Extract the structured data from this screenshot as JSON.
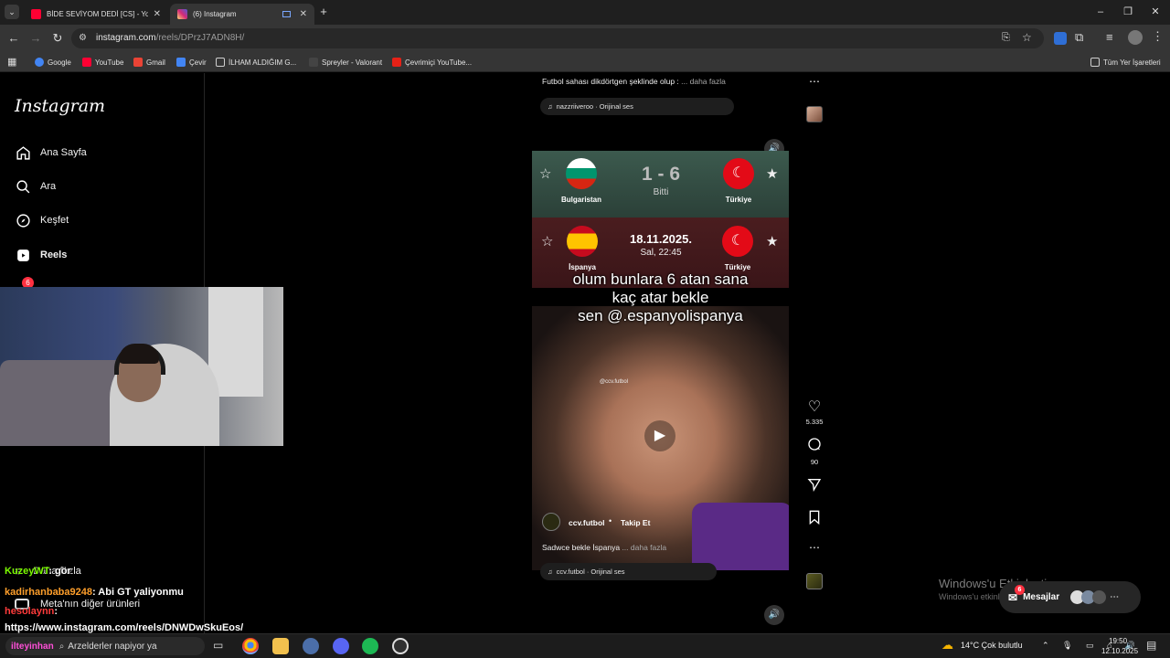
{
  "browser": {
    "tabs": [
      {
        "label": "BİDE SEVİYOM DEDİ [CS] - YouT",
        "favicon": "youtube-icon",
        "color": "#ff0033"
      },
      {
        "label": "(6) Instagram",
        "favicon": "instagram-icon",
        "color": "#d62976"
      }
    ],
    "url_host": "instagram.com",
    "url_path": "/reels/DPrzJ7ADN8H/",
    "bookmarks": [
      {
        "label": "Google",
        "icon": "google-icon",
        "color": "#4285f4"
      },
      {
        "label": "YouTube",
        "icon": "youtube-icon",
        "color": "#ff0033"
      },
      {
        "label": "Gmail",
        "icon": "gmail-icon",
        "color": "#ea4335"
      },
      {
        "label": "Çevir",
        "icon": "translate-icon",
        "color": "#4285f4"
      },
      {
        "label": "İLHAM ALDIĞIM G...",
        "icon": "folder-icon",
        "color": "#cfcfcf"
      },
      {
        "label": "Spreyler - Valorant",
        "icon": "valorant-icon",
        "color": "#333"
      },
      {
        "label": "Çevrimiçi YouTube...",
        "icon": "bookmark-icon",
        "color": "#e62117"
      }
    ],
    "all_bookmarks": "Tüm Yer İşaretleri"
  },
  "instagram": {
    "logo": "Instagram",
    "nav": [
      {
        "label": "Ana Sayfa",
        "icon": "home-icon"
      },
      {
        "label": "Ara",
        "icon": "search-icon"
      },
      {
        "label": "Keşfet",
        "icon": "compass-icon"
      },
      {
        "label": "Reels",
        "icon": "reels-icon"
      }
    ],
    "messages_badge": "6",
    "more_label": "Daha fazla",
    "meta_label": "Meta'nın diğer ürünleri",
    "prev_caption": "Futbol sahası dikdörtgen şeklinde olup :",
    "prev_caption_more": "... daha fazla",
    "prev_audio": "nazzriiveroo · Orijinal ses",
    "reel": {
      "score": "1 - 6",
      "status": "Bitti",
      "home": "Bulgaristan",
      "away": "Türkiye",
      "next_date": "18.11.2025.",
      "next_time": "Sal, 22:45",
      "next_home": "İspanya",
      "next_away": "Türkiye",
      "overlay": [
        "olum bunlara 6 atan sana",
        "kaç atar bekle",
        "sen @.espanyolispanya"
      ],
      "watermark": "@ccv.futbol",
      "username": "ccv.futbol",
      "follow": "Takip Et",
      "caption": "Sadwce bekle İspanya",
      "caption_more": "... daha fazla",
      "audio": "ccv.futbol · Orijinal ses",
      "likes": "5.335",
      "comments": "90"
    },
    "messages_label": "Mesajlar",
    "messages_count": "6"
  },
  "windows_watermark": {
    "line1": "Windows'u Etkinleştir",
    "line2": "Windows'u etkinleştirmek için Ayarlar'a gidin."
  },
  "chat": [
    {
      "user": "KuzeyWT",
      "text": ": gör",
      "color": "#7cfc00"
    },
    {
      "user": "kadirhanbaba9248",
      "text": ": Abi GT yaliyonmu",
      "color": "#ff9f2b"
    },
    {
      "user": "hesolaynn",
      "text": ":",
      "color": "#ff3b3b"
    },
    {
      "user": "",
      "text": "https://www.instagram.com/reels/DNWDwSkuEos/",
      "color": "#ffffff"
    }
  ],
  "taskbar": {
    "search_user": "ilteyinhan",
    "search_text": "Arzelderler napiyor ya",
    "weather": "14°C  Çok bulutlu",
    "time": "19:50",
    "date": "12.10.2025"
  }
}
